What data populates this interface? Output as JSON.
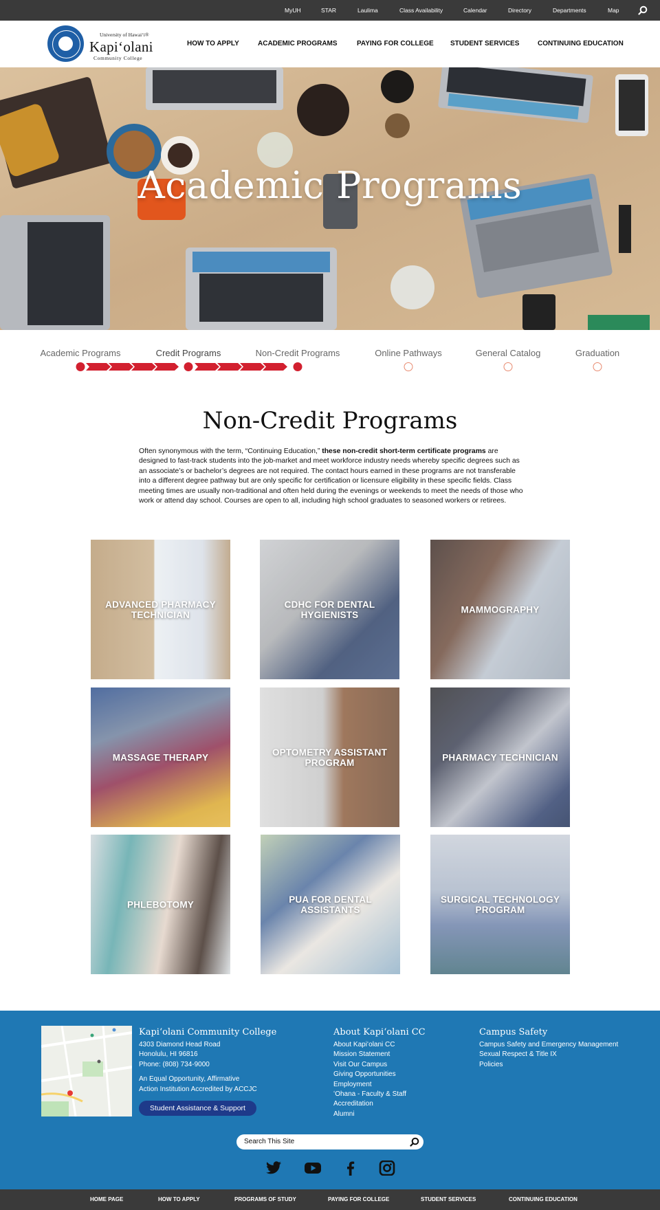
{
  "utility_nav": {
    "links": [
      "MyUH",
      "STAR",
      "Laulima",
      "Class Availability",
      "Calendar",
      "Directory",
      "Departments",
      "Map"
    ]
  },
  "logo": {
    "line1": "University of Hawaiʻi®",
    "line2": "Kapiʻolani",
    "line3": "Community College"
  },
  "main_nav": [
    "HOW TO APPLY",
    "ACADEMIC PROGRAMS",
    "PAYING FOR COLLEGE",
    "STUDENT SERVICES",
    "CONTINUING EDUCATION"
  ],
  "hero": {
    "title": "Academic Programs"
  },
  "steps": {
    "items": [
      {
        "label": "Academic Programs",
        "state": "done"
      },
      {
        "label": "Credit Programs",
        "state": "done"
      },
      {
        "label": "Non-Credit Programs",
        "state": "current"
      },
      {
        "label": "Online Pathways",
        "state": "todo"
      },
      {
        "label": "General Catalog",
        "state": "todo"
      },
      {
        "label": "Graduation",
        "state": "todo"
      }
    ]
  },
  "intro": {
    "title": "Non-Credit Programs",
    "text_lead": "Often synonymous with the term, “Continuing Education,” ",
    "text_bold": "these non-credit short-term certificate programs",
    "text_rest": " are designed to fast-track students into the job-market and meet workforce industry needs whereby specific degrees such as an associate’s or bachelor’s degrees are not required. The contact hours earned in these programs are not transferable into a different degree pathway but are only specific for certification or licensure eligibility in these specific fields. Class meeting times are usually non-traditional and often held during the evenings or weekends to meet the needs of those who work or attend day school. Courses are open to all, including high school graduates to seasoned workers or retirees."
  },
  "programs": [
    {
      "label": "ADVANCED PHARMACY TECHNICIAN"
    },
    {
      "label": "CDHC FOR DENTAL HYGIENISTS"
    },
    {
      "label": "MAMMOGRAPHY"
    },
    {
      "label": "MASSAGE THERAPY"
    },
    {
      "label": "OPTOMETRY ASSISTANT PROGRAM"
    },
    {
      "label": "PHARMACY TECHNICIAN"
    },
    {
      "label": "PHLEBOTOMY"
    },
    {
      "label": "PUA FOR DENTAL ASSISTANTS"
    },
    {
      "label": "SURGICAL TECHNOLOGY PROGRAM"
    }
  ],
  "footer": {
    "college": {
      "title": "Kapiʻolani Community College",
      "address1": "4303 Diamond Head Road",
      "address2": "Honolulu, HI 96816",
      "phone": "Phone: (808) 734-9000",
      "eeo1": "An Equal Opportunity, Affirmative",
      "eeo2": "Action Institution Accredited by ACCJC",
      "button": "Student Assistance & Support"
    },
    "about": {
      "title": "About Kapiʻolani CC",
      "links": [
        "About Kapiʻolani CC",
        "Mission Statement",
        "Visit Our Campus",
        "Giving Opportunities",
        "Employment",
        "ʻOhana - Faculty & Staff",
        "Accreditation",
        "Alumni"
      ]
    },
    "safety": {
      "title": "Campus Safety",
      "links": [
        "Campus Safety and Emergency Management",
        "Sexual Respect & Title IX",
        "Policies"
      ]
    },
    "search_placeholder": "Search This Site",
    "social": [
      "twitter-icon",
      "youtube-icon",
      "facebook-icon",
      "instagram-icon"
    ]
  },
  "bottom_nav": [
    "HOME PAGE",
    "HOW TO APPLY",
    "PROGRAMS OF STUDY",
    "PAYING FOR COLLEGE",
    "STUDENT SERVICES",
    "CONTINUING EDUCATION"
  ],
  "colors": {
    "accent_red": "#d2202f",
    "footer_blue": "#1f78b4",
    "dark_bar": "#3a3a3a",
    "button_blue": "#1e3a8a"
  }
}
